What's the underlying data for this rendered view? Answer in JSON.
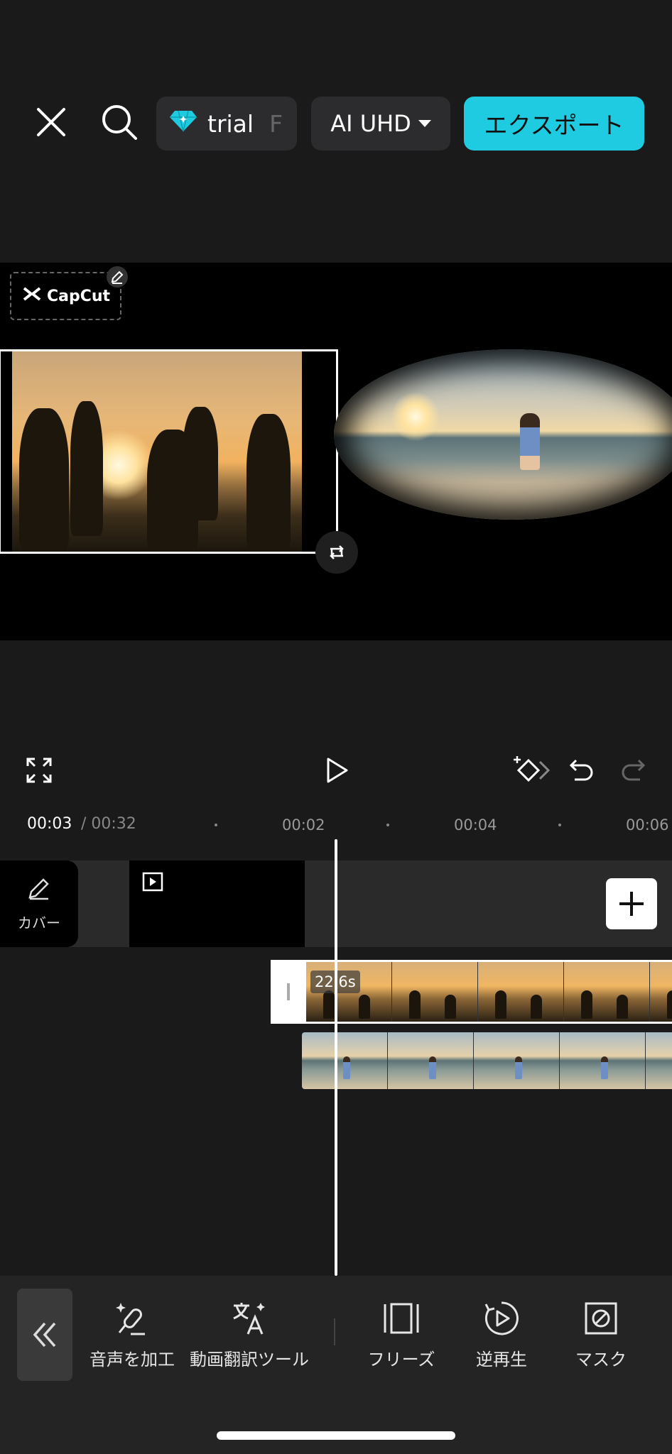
{
  "topbar": {
    "trial_label": "trial",
    "trial_overflow": "F",
    "resolution_label": "AI UHD",
    "export_label": "エクスポート",
    "accent_color": "#1ecbe1"
  },
  "preview": {
    "watermark_text": "CapCut"
  },
  "timeline": {
    "current_time": "00:03",
    "total_time": "/ 00:32",
    "ticks": [
      "00:02",
      "00:04",
      "00:06"
    ],
    "cover_label": "カバー",
    "clip_duration": "22.6s"
  },
  "toolbar": {
    "items": [
      {
        "label": "音声を加工",
        "icon": "voice-effect-icon"
      },
      {
        "label": "動画翻訳ツール",
        "icon": "translate-icon"
      },
      {
        "label": "フリーズ",
        "icon": "freeze-icon"
      },
      {
        "label": "逆再生",
        "icon": "reverse-icon"
      },
      {
        "label": "マスク",
        "icon": "mask-icon"
      }
    ]
  }
}
